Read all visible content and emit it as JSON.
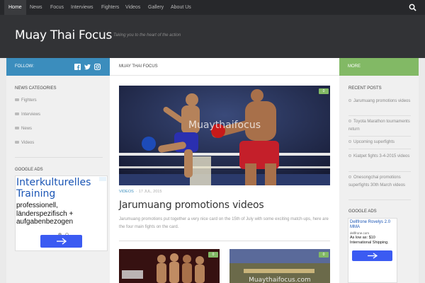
{
  "nav": {
    "items": [
      "Home",
      "News",
      "Focus",
      "Interviews",
      "Fighters",
      "Videos",
      "Gallery",
      "About Us"
    ],
    "active": "Home",
    "search_icon": "search-icon"
  },
  "header": {
    "title": "Muay Thai Focus",
    "tagline": "Taking you to the heart of the action"
  },
  "left": {
    "follow_label": "FOLLOW:",
    "social_icons": [
      "facebook-icon",
      "twitter-icon",
      "instagram-icon"
    ],
    "categories_title": "NEWS CATEGORIES",
    "categories": [
      "Fighters",
      "Interviews",
      "News",
      "Videos"
    ],
    "ads_title": "GOOGLE ADS",
    "ad": {
      "headline": "Interkulturelles Training",
      "body": "professionell, länderspezifisch + aufgabenbezogen"
    }
  },
  "main": {
    "section_label": "MUAY THAI FOCUS",
    "post": {
      "comments": "0",
      "watermark": "Muaythaifocus",
      "category": "VIDEOS",
      "date": "17 JUL, 2015",
      "title": "Jarumuang promotions videos",
      "excerpt": "Jarumuang promotions put together a very nice card on the 15th of July with some exciting match-ups, here are the four main fights on the card."
    },
    "thumbs": [
      {
        "comments": "0",
        "caption": ""
      },
      {
        "comments": "0",
        "caption": "Muaythaifocus.com"
      }
    ]
  },
  "right": {
    "more_label": "MORE",
    "recent_title": "RECENT POSTS",
    "recent_posts": [
      "Jarumuang promotions videos",
      "Toyota Marathon tournaments return",
      "Upcoming superfights",
      "Kiatpet fights 3-4-2015 videos",
      "Onesongchai promotions superfights 30th March videos"
    ],
    "ads_title": "GOOGLE ADS",
    "ad": {
      "headline": "Dellfrone Rovelys 2.0 MMA",
      "domain": "dellfrone.com",
      "body": "As low as: $10 International Shipping."
    }
  },
  "colors": {
    "accent_blue": "#3b8dbd",
    "accent_green": "#82b965",
    "nav_bg": "#27282b",
    "header_bg": "#323336"
  }
}
